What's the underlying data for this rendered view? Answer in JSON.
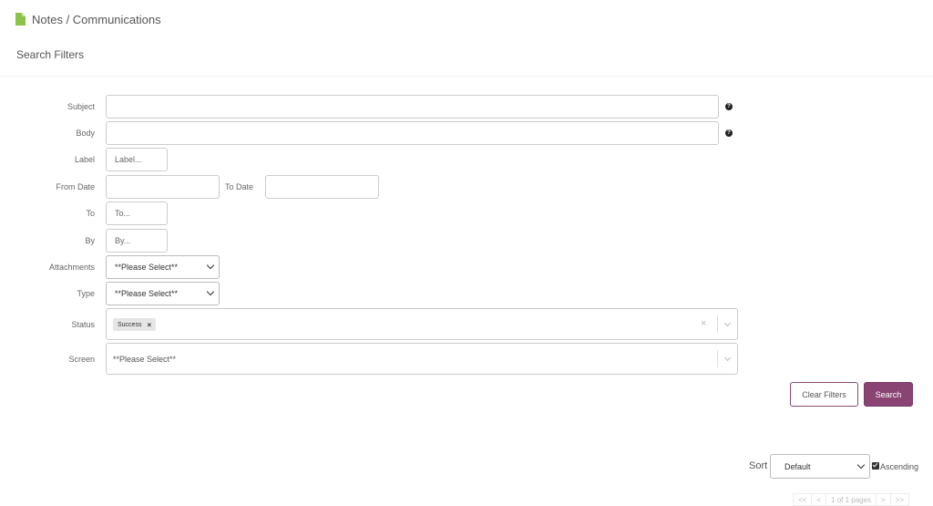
{
  "header": {
    "title": "Notes / Communications",
    "icon": "document-icon",
    "icon_color": "#8bc34a"
  },
  "filters": {
    "title": "Search Filters",
    "subject": {
      "label": "Subject",
      "value": ""
    },
    "body": {
      "label": "Body",
      "value": ""
    },
    "label": {
      "label": "Label",
      "placeholder": "Label..."
    },
    "from_date": {
      "label": "From Date",
      "value": ""
    },
    "to_date": {
      "label": "To Date",
      "value": ""
    },
    "to": {
      "label": "To",
      "placeholder": "To..."
    },
    "by": {
      "label": "By",
      "placeholder": "By..."
    },
    "attachments": {
      "label": "Attachments",
      "selected": "**Please Select**"
    },
    "type": {
      "label": "Type",
      "selected": "**Please Select**"
    },
    "status": {
      "label": "Status",
      "tags": [
        "Success"
      ],
      "tag_remove": "×",
      "clear": "×"
    },
    "screen": {
      "label": "Screen",
      "placeholder": "**Please Select**"
    },
    "help_glyph": "?"
  },
  "buttons": {
    "clear": "Clear Filters",
    "search": "Search",
    "accent": "#8a4474"
  },
  "sort": {
    "label": "Sort",
    "selected": "Default",
    "ascending_label": "Ascending",
    "ascending": true
  },
  "pager": {
    "first": "<<",
    "prev": "<",
    "info": "1 of 1 pages",
    "next": ">",
    "last": ">>"
  }
}
